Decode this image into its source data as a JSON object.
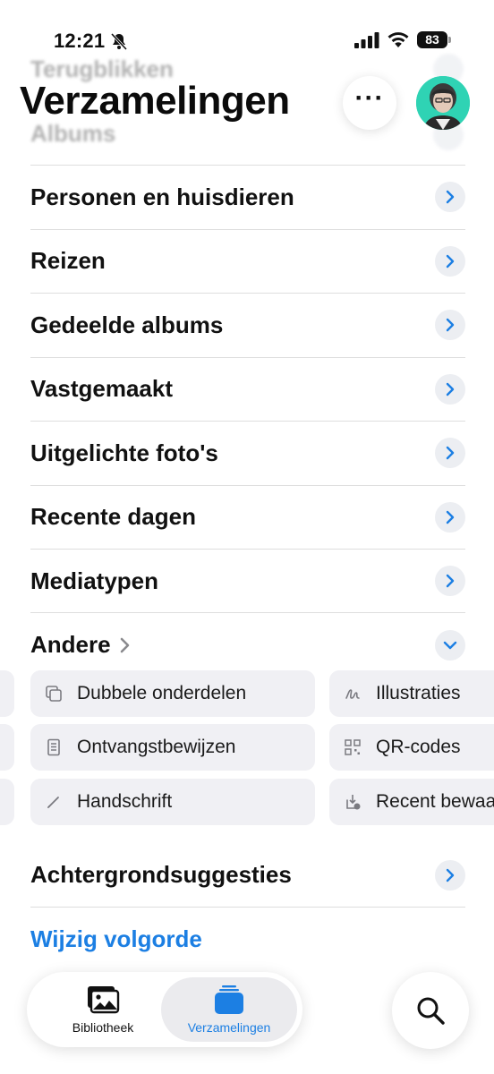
{
  "status_bar": {
    "time": "12:21",
    "battery": "83"
  },
  "header": {
    "title": "Verzamelingen"
  },
  "ghost_rows": [
    {
      "label": "Terugblikken"
    },
    {
      "label": "Albums"
    }
  ],
  "list": {
    "items": [
      {
        "label": "Personen en huisdieren"
      },
      {
        "label": "Reizen"
      },
      {
        "label": "Gedeelde albums"
      },
      {
        "label": "Vastgemaakt"
      },
      {
        "label": "Uitgelichte foto's"
      },
      {
        "label": "Recente dagen"
      },
      {
        "label": "Mediatypen"
      }
    ]
  },
  "andere": {
    "label": "Andere",
    "chips": [
      {
        "label": "Dubbele onderdelen",
        "icon": "duplicate-icon"
      },
      {
        "label": "Illustraties",
        "icon": "illustration-icon"
      },
      {
        "label": "Ontvangstbewijzen",
        "icon": "receipt-icon"
      },
      {
        "label": "QR-codes",
        "icon": "qr-code-icon"
      },
      {
        "label": "Handschrift",
        "icon": "pencil-icon"
      },
      {
        "label": "Recent bewaa",
        "icon": "recently-saved-icon"
      }
    ]
  },
  "achtergrond": {
    "label": "Achtergrondsuggesties"
  },
  "edit_order": {
    "label": "Wijzig volgorde"
  },
  "tab_bar": {
    "library_label": "Bibliotheek",
    "collections_label": "Verzamelingen",
    "active": "Verzamelingen"
  },
  "colors": {
    "accent": "#1c7fe3",
    "chip_bg": "#f0f0f4",
    "chevron_bg": "#eceef2"
  }
}
